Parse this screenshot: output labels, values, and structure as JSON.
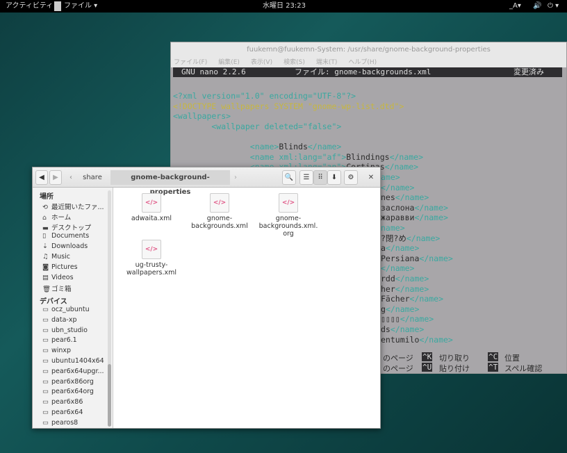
{
  "topbar": {
    "activities": "アクティビティ",
    "app_menu": "ファイル ▾",
    "clock": "水曜日 23:23",
    "input_method": "_A▾",
    "volume_icon": "🔊",
    "power_icon": "⏻ ▾"
  },
  "terminal": {
    "title": "fuukemn@fuukemn-System: /usr/share/gnome-background-properties",
    "menu": [
      "ファイル(F)",
      "編集(E)",
      "表示(V)",
      "検索(S)",
      "端末(T)",
      "ヘルプ(H)"
    ],
    "nano": {
      "version": "GNU nano 2.2.6",
      "file": "ファイル: gnome-backgrounds.xml",
      "status": "変更済み"
    },
    "lines": [
      {
        "tag": "<?xml version=\"1.0\" encoding=\"UTF-8\"?>",
        "text": ""
      },
      {
        "tag": "<!DOCTYPE wallpapers SYSTEM \"gnome-wp-list.dtd\">",
        "text": ""
      },
      {
        "tag": "<wallpapers>",
        "text": ""
      },
      {
        "tag": "        <wallpaper deleted=\"false\">",
        "text": ""
      },
      {
        "tag": "",
        "text": ""
      },
      {
        "tag": "                <name>",
        "text": "Blinds",
        "end": "</name>"
      },
      {
        "tag": "                <name xml:lang=\"af\">",
        "text": "Blindings",
        "end": "</name>"
      },
      {
        "tag": "                <name xml:lang=\"an\">",
        "text": "Cortinas",
        "end": "</name>"
      }
    ],
    "fragments": [
      {
        "text": "",
        "end": "ame>"
      },
      {
        "text": "",
        "end": "</name>"
      },
      {
        "text": "nes",
        "end": "</name>"
      },
      {
        "text": "заслона",
        "end": "</name>"
      },
      {
        "text": "жаравви",
        "end": "</name>"
      },
      {
        "text": "",
        "end": "name>"
      },
      {
        "text": "?閉?め",
        "end": "</name>"
      },
      {
        "text": "a",
        "end": "</name>"
      },
      {
        "text": "Persiana",
        "end": "</name>"
      },
      {
        "text": "",
        "end": "</name>"
      },
      {
        "text": "rdd",
        "end": "</name>"
      },
      {
        "text": "her",
        "end": "</name>"
      },
      {
        "text": "Fächer",
        "end": "</name>"
      },
      {
        "text": "g",
        "end": "</name>"
      },
      {
        "text": "▯▯▯▯",
        "end": "</name>"
      },
      {
        "text": "ds",
        "end": "</name>"
      },
      {
        "text": "entumilo",
        "end": "</name>"
      }
    ],
    "shortcuts": [
      {
        "a": "のページ",
        "k1": "^K",
        "b": "切り取り",
        "k2": "^C",
        "c": "位置"
      },
      {
        "a": "のページ",
        "k1": "^U",
        "b": "貼り付け",
        "k2": "^T",
        "c": "スペル確認"
      }
    ]
  },
  "files": {
    "breadcrumb": [
      "share",
      "gnome-background-properties"
    ],
    "toolbar": {
      "back": "◀",
      "forward": "▶",
      "crumb_left": "‹",
      "crumb_right": "›",
      "search": "🔍",
      "list": "☰",
      "grid": "⠿",
      "sort": "⬇",
      "settings": "⚙",
      "close": "✕"
    },
    "sidebar": {
      "places_header": "場所",
      "places": [
        {
          "icon": "⟲",
          "label": "最近開いたファ..."
        },
        {
          "icon": "⌂",
          "label": "ホーム"
        },
        {
          "icon": "▬",
          "label": "デスクトップ"
        },
        {
          "icon": "▯",
          "label": "Documents"
        },
        {
          "icon": "⇣",
          "label": "Downloads"
        },
        {
          "icon": "♫",
          "label": "Music"
        },
        {
          "icon": "◙",
          "label": "Pictures"
        },
        {
          "icon": "▤",
          "label": "Videos"
        },
        {
          "icon": "🗑",
          "label": "ゴミ箱"
        }
      ],
      "devices_header": "デバイス",
      "devices": [
        "ocz_ubuntu",
        "data-xp",
        "ubn_studio",
        "pear6.1",
        "winxp",
        "ubuntu1404x64",
        "pear6x64upgr...",
        "pear6x86org",
        "pear6x64org",
        "pear6x86",
        "pear6x64",
        "pearos8"
      ]
    },
    "items": [
      {
        "name": "adwaita.xml"
      },
      {
        "name": "gnome-backgrounds.xml"
      },
      {
        "name": "gnome-backgrounds.xml.org"
      },
      {
        "name": "ug-trusty-wallpapers.xml"
      }
    ],
    "file_icon": "</>"
  }
}
